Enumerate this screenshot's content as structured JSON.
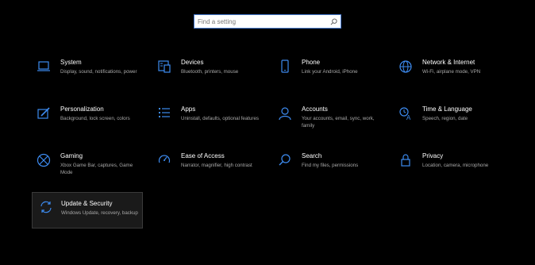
{
  "search": {
    "placeholder": "Find a setting"
  },
  "accent": "#3d8bf0",
  "tiles": [
    {
      "name": "system",
      "icon": "laptop-icon",
      "title": "System",
      "desc": "Display, sound, notifications, power"
    },
    {
      "name": "devices",
      "icon": "keyboard-devices-icon",
      "title": "Devices",
      "desc": "Bluetooth, printers, mouse"
    },
    {
      "name": "phone",
      "icon": "phone-icon",
      "title": "Phone",
      "desc": "Link your Android, iPhone"
    },
    {
      "name": "network",
      "icon": "globe-icon",
      "title": "Network & Internet",
      "desc": "Wi-Fi, airplane mode, VPN"
    },
    {
      "name": "personalization",
      "icon": "paintbrush-icon",
      "title": "Personalization",
      "desc": "Background, lock screen, colors"
    },
    {
      "name": "apps",
      "icon": "apps-list-icon",
      "title": "Apps",
      "desc": "Uninstall, defaults, optional features"
    },
    {
      "name": "accounts",
      "icon": "person-icon",
      "title": "Accounts",
      "desc": "Your accounts, email, sync, work, family"
    },
    {
      "name": "time-language",
      "icon": "time-language-icon",
      "title": "Time & Language",
      "desc": "Speech, region, date"
    },
    {
      "name": "gaming",
      "icon": "xbox-icon",
      "title": "Gaming",
      "desc": "Xbox Game Bar, captures, Game Mode"
    },
    {
      "name": "ease-of-access",
      "icon": "ease-of-access-icon",
      "title": "Ease of Access",
      "desc": "Narrator, magnifier, high contrast"
    },
    {
      "name": "search",
      "icon": "search-icon",
      "title": "Search",
      "desc": "Find my files, permissions"
    },
    {
      "name": "privacy",
      "icon": "lock-icon",
      "title": "Privacy",
      "desc": "Location, camera, microphone"
    },
    {
      "name": "update-security",
      "icon": "sync-arrows-icon",
      "title": "Update & Security",
      "desc": "Windows Update, recovery, backup"
    }
  ]
}
